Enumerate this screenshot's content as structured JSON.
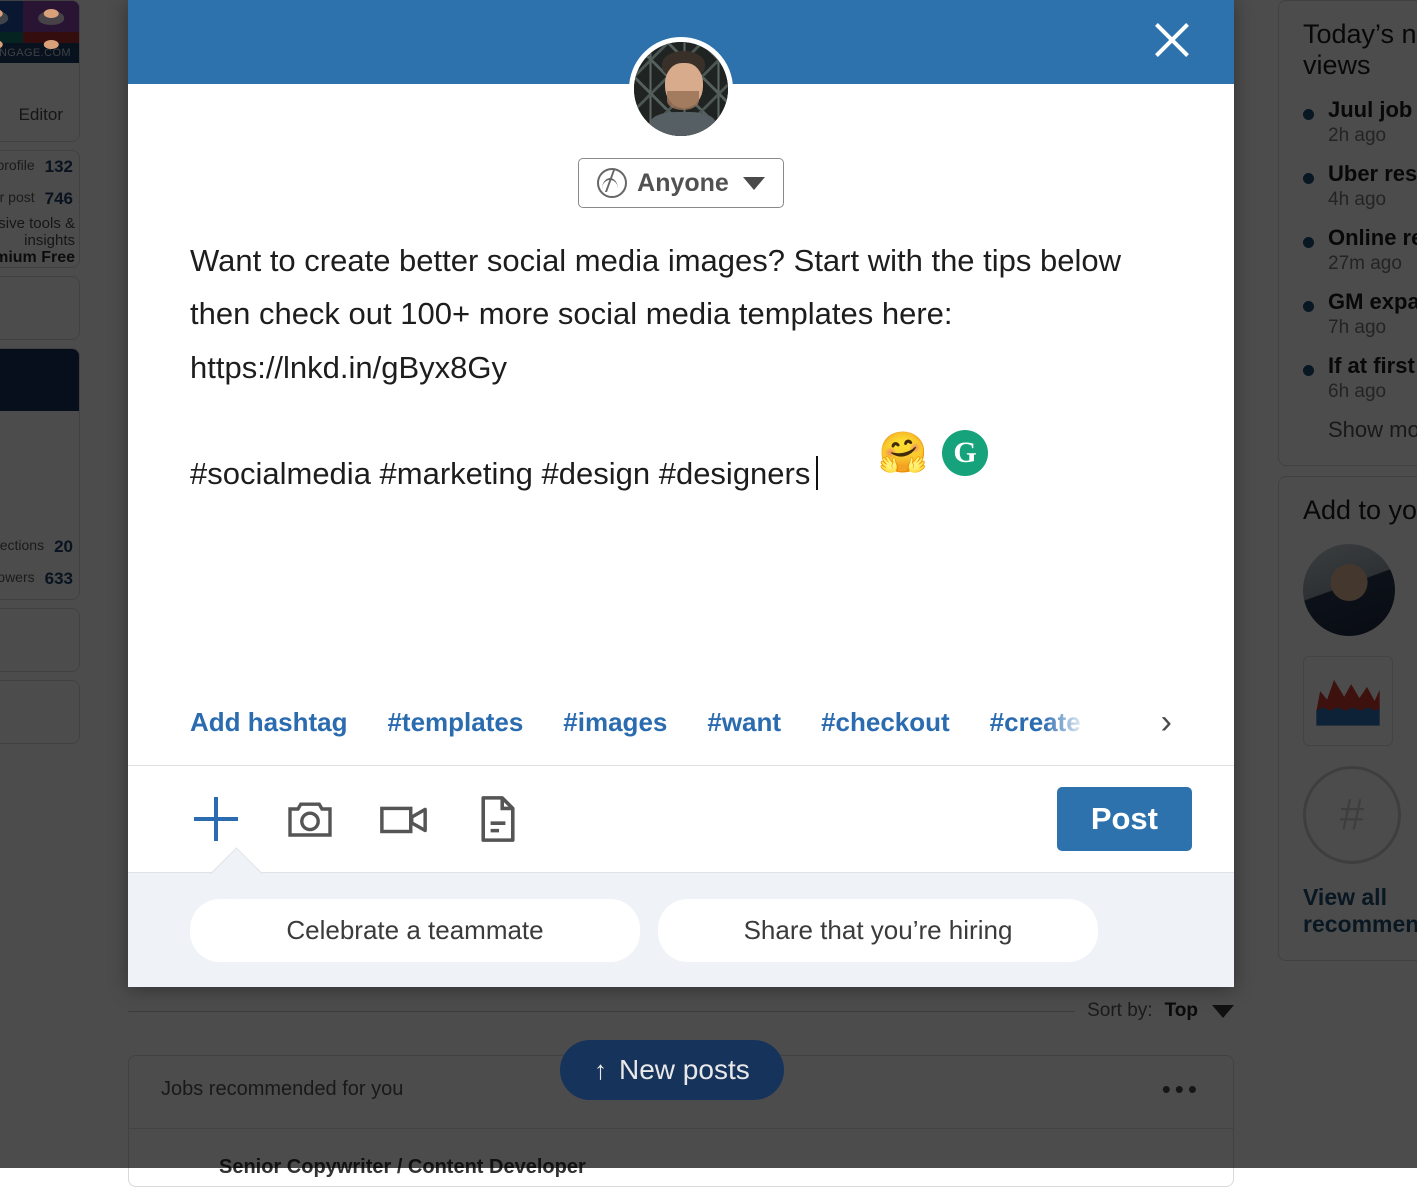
{
  "modal": {
    "close_icon": "close-icon",
    "avatar_alt": "user-avatar",
    "audience": {
      "icon": "globe-icon",
      "label": "Anyone",
      "caret": "chevron-down-icon"
    },
    "post_text": "Want to create better social media images? Start with the tips below then check out 100+ more social media templates here: https://lnkd.in/gByx8Gy\n\n#socialmedia #marketing #design #designers",
    "assist": {
      "emoji_icon": "🤗",
      "grammarly_icon": "G"
    },
    "hashtags": {
      "add_label": "Add hashtag",
      "suggestions": [
        "#templates",
        "#images",
        "#want",
        "#checkout",
        "#create"
      ],
      "next_icon": "›"
    },
    "toolbar": {
      "icons": [
        "plus-icon",
        "camera-icon",
        "video-icon",
        "document-icon"
      ],
      "post_label": "Post"
    },
    "suggestion_chips": [
      "Celebrate a teammate",
      "Share that you’re hiring"
    ]
  },
  "background": {
    "new_posts": {
      "arrow": "↑",
      "label": "New posts"
    },
    "sort": {
      "label": "Sort by:",
      "value": "Top",
      "caret": "chevron-down-icon"
    },
    "jobs_card": {
      "title": "Jobs recommended for you",
      "menu_icon": "•••",
      "subtitle": "Senior Copywriter / Content Developer"
    },
    "left_rail": {
      "cover_domain": "ENGAGE.COM",
      "role": "Editor",
      "stats": [
        {
          "label": "Who viewed your profile",
          "value": "132"
        },
        {
          "label": "Views of your post",
          "value": "746"
        }
      ],
      "links": [
        "Access exclusive tools & insights",
        "Try Premium Free"
      ],
      "stats2": [
        {
          "label": "Connections",
          "value": "20"
        },
        {
          "label": "Followers",
          "value": "633"
        }
      ]
    },
    "right_rail": {
      "news_title": "Today’s news and views",
      "news_items": [
        {
          "headline": "Juul job cuts loom",
          "time": "2h ago"
        },
        {
          "headline": "Uber results fall short",
          "time": "4h ago"
        },
        {
          "headline": "Online retail sales surge",
          "time": "27m ago"
        },
        {
          "headline": "GM expands EV line-up",
          "time": "7h ago"
        },
        {
          "headline": "If at first you don’t succeed",
          "time": "6h ago"
        }
      ],
      "show_more": "Show more",
      "feed_title": "Add to your feed",
      "feed_view_all": "View all recommendations"
    }
  }
}
